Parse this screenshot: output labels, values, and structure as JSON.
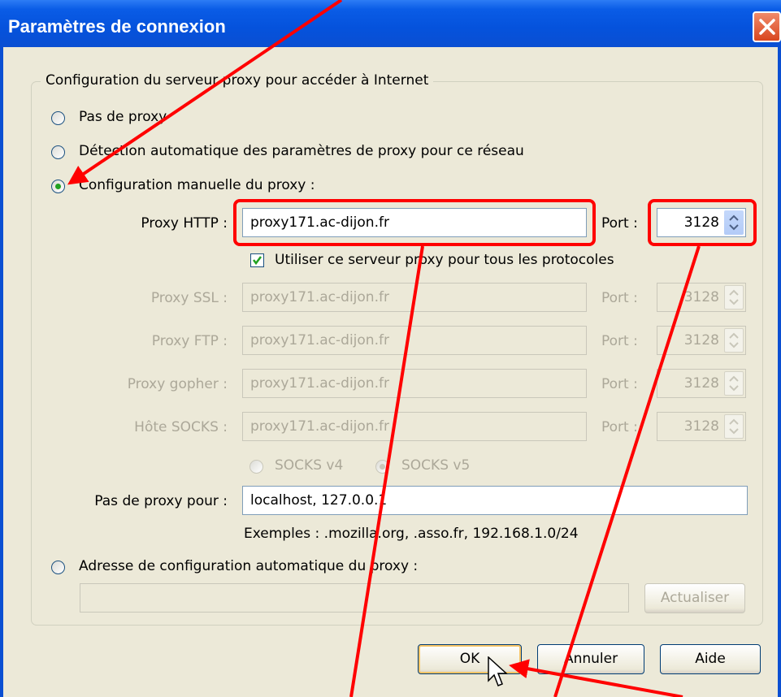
{
  "window": {
    "title": "Paramètres de connexion",
    "close_label": "close"
  },
  "group": {
    "legend": "Configuration du serveur proxy pour accéder à Internet"
  },
  "radios": {
    "no_proxy": "Pas de proxy",
    "auto_detect": "Détection automatique des paramètres de proxy pour ce réseau",
    "manual": "Configuration manuelle du proxy :",
    "auto_config": "Adresse de configuration automatique du proxy :",
    "selected": "manual"
  },
  "proxy_http": {
    "label": "Proxy HTTP :",
    "value": "proxy171.ac-dijon.fr",
    "port_label": "Port :",
    "port": "3128"
  },
  "use_for_all": {
    "label": "Utiliser ce serveur proxy pour tous les protocoles",
    "checked": true
  },
  "proxies": [
    {
      "label": "Proxy SSL :",
      "value": "proxy171.ac-dijon.fr",
      "port_label": "Port :",
      "port": "3128"
    },
    {
      "label": "Proxy FTP :",
      "value": "proxy171.ac-dijon.fr",
      "port_label": "Port :",
      "port": "3128"
    },
    {
      "label": "Proxy gopher :",
      "value": "proxy171.ac-dijon.fr",
      "port_label": "Port :",
      "port": "3128"
    },
    {
      "label": "Hôte SOCKS :",
      "value": "proxy171.ac-dijon.fr",
      "port_label": "Port :",
      "port": "3128"
    }
  ],
  "socks": {
    "v4": "SOCKS v4",
    "v5": "SOCKS v5",
    "selected": "v5"
  },
  "no_proxy_for": {
    "label": "Pas de proxy pour :",
    "value": "localhost, 127.0.0.1",
    "examples": "Exemples : .mozilla.org, .asso.fr, 192.168.1.0/24"
  },
  "auto_config_url": {
    "value": "",
    "reload_label": "Actualiser"
  },
  "buttons": {
    "ok": "OK",
    "cancel": "Annuler",
    "help": "Aide"
  },
  "colors": {
    "titlebar": "#0552dc",
    "annotation": "#ff0000",
    "dialog_bg": "#ece9d8"
  }
}
